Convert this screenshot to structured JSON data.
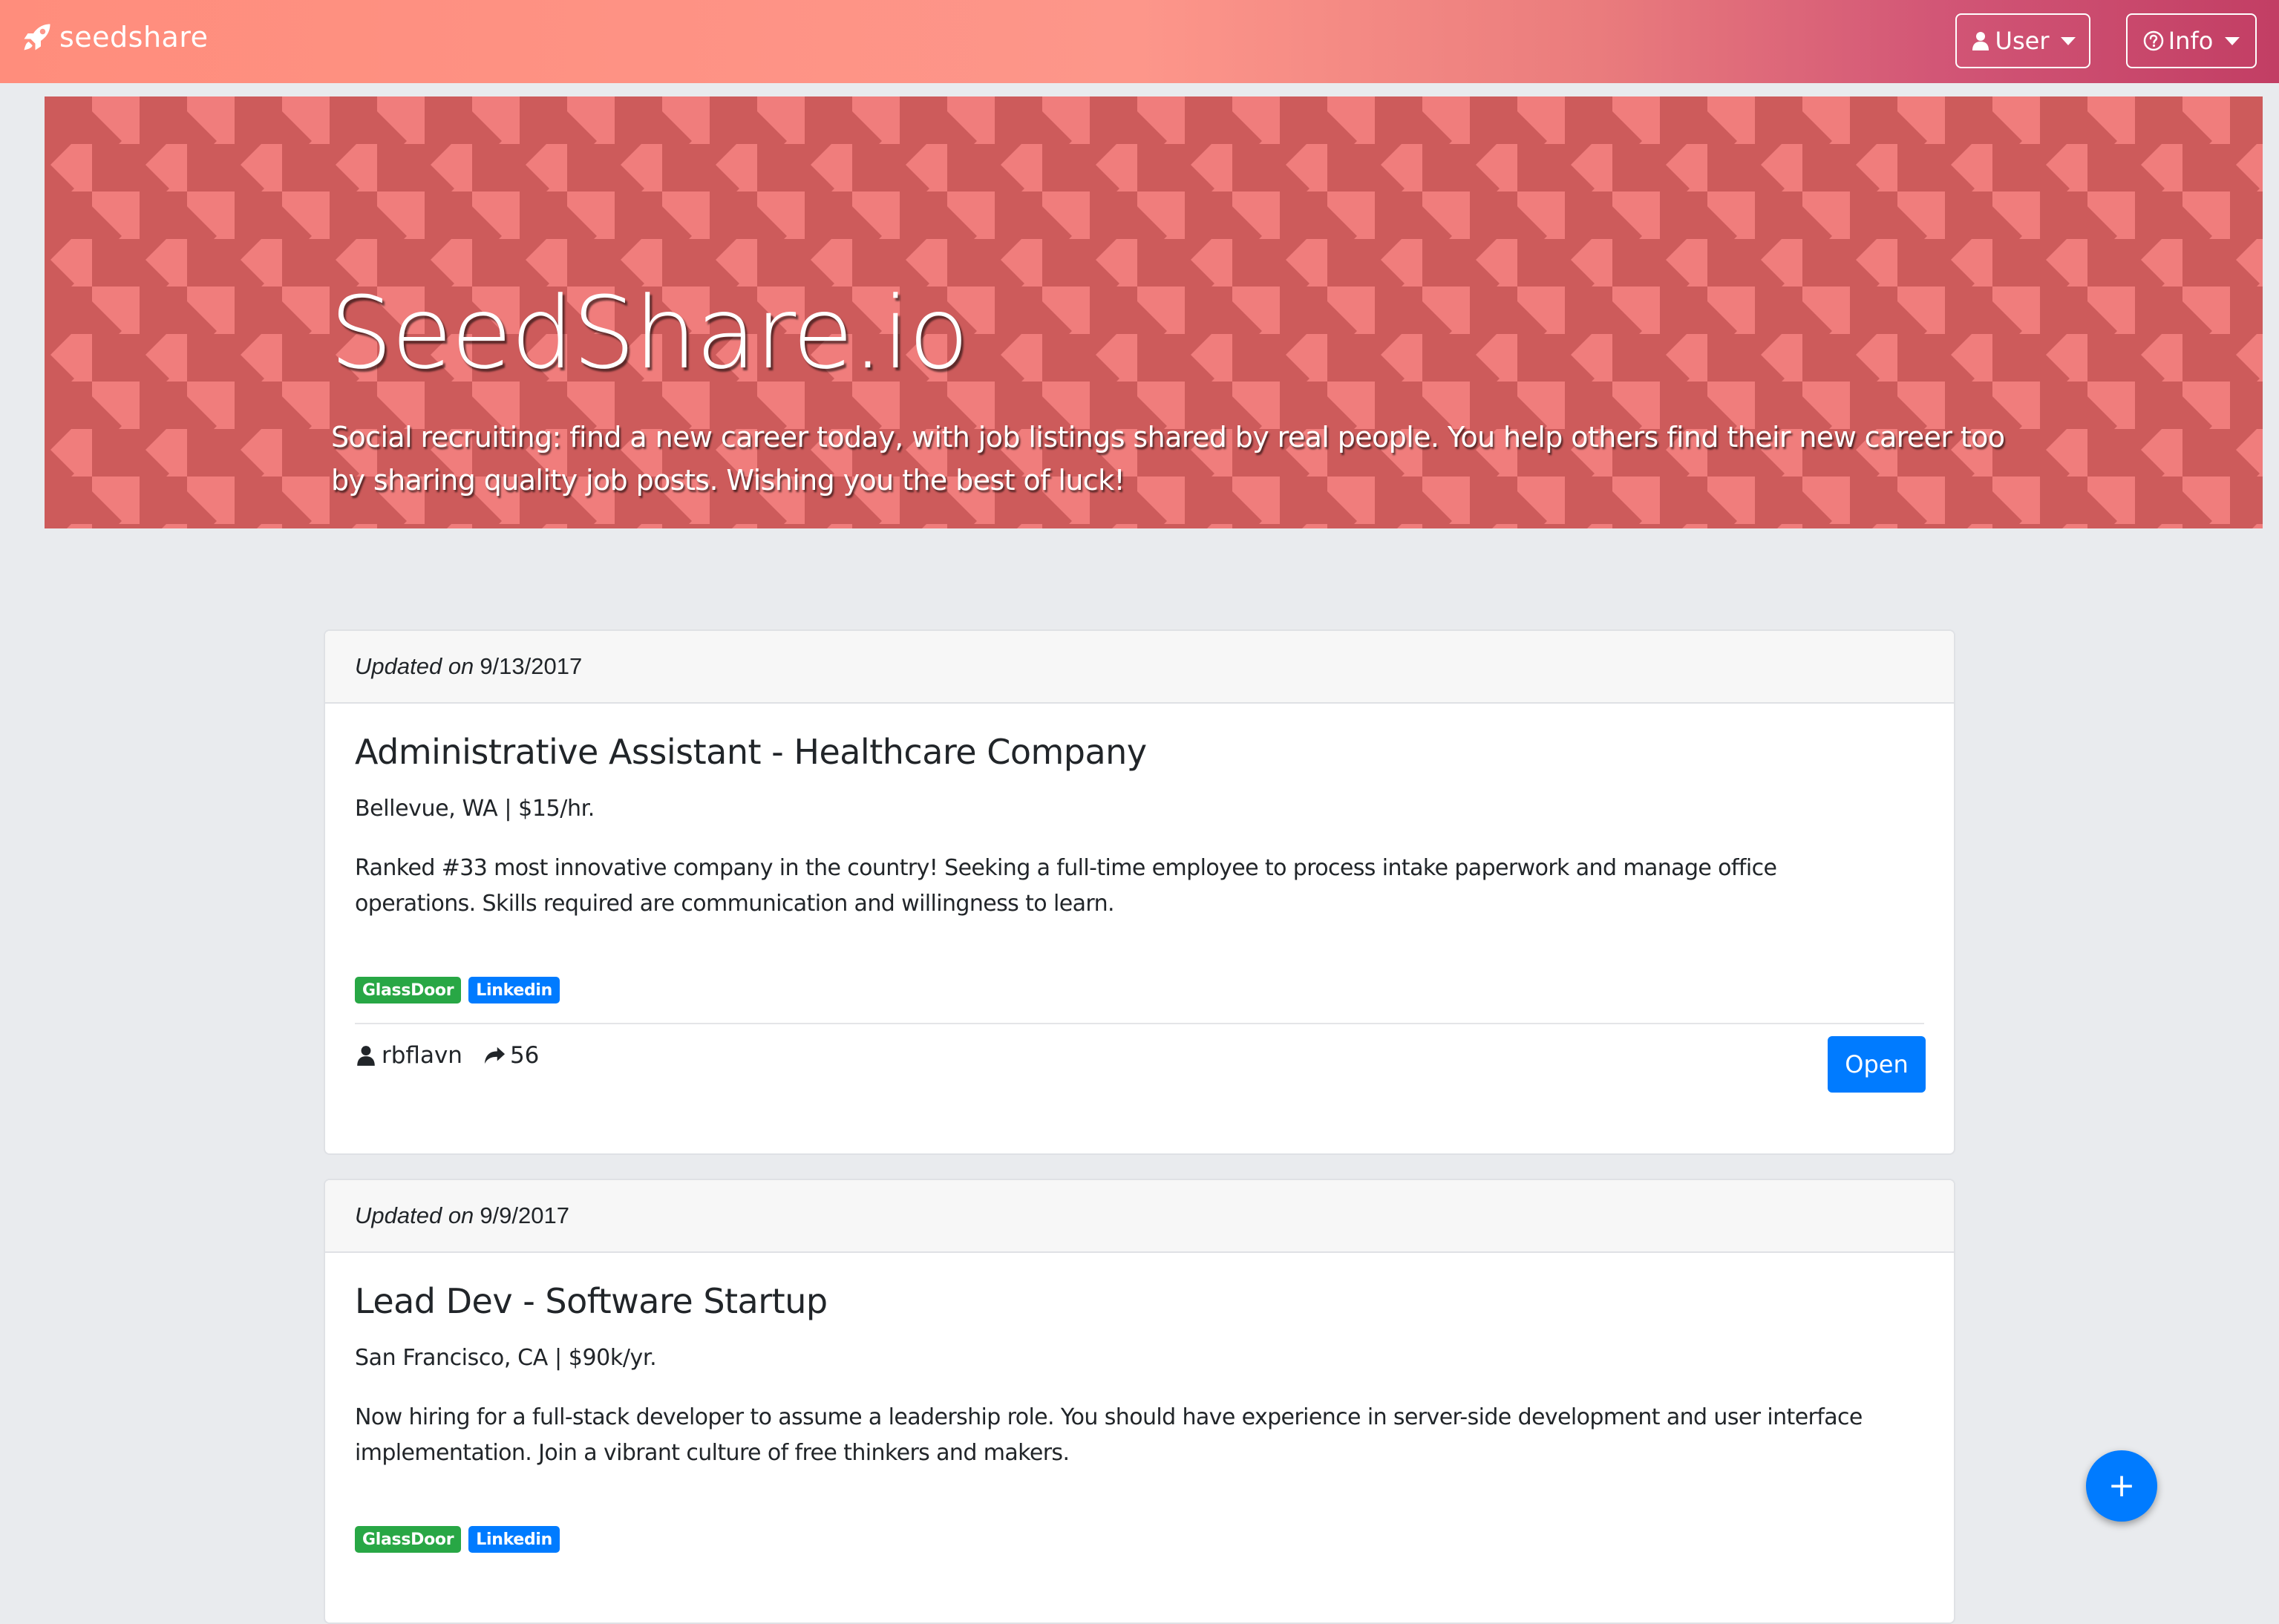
{
  "navbar": {
    "brand": "seedshare",
    "brand_icon": "rocket-icon",
    "user_label": "User",
    "user_icon": "user-icon",
    "info_label": "Info",
    "info_icon": "question-circle-icon",
    "gradient_colors": [
      "#ff8d7c",
      "#c23e64"
    ]
  },
  "hero": {
    "title": "SeedShare.io",
    "subtitle": "Social recruiting: find a new career today, with job listings shared by real people. You help others find their new career too by sharing quality job posts. Wishing you the best of luck!",
    "pattern_colors": [
      "#f07d7c",
      "#cd5b5b"
    ]
  },
  "jobs": [
    {
      "updated_prefix": "Updated on",
      "updated_date": "9/13/2017",
      "title": "Administrative Assistant - Healthcare Company",
      "meta": "Bellevue, WA | $15/hr.",
      "description": "Ranked #33 most innovative company in the country! Seeking a full-time employee to process intake paperwork and manage office operations. Skills required are communication and willingness to learn.",
      "tags": [
        "GlassDoor",
        "Linkedin"
      ],
      "author": "rbflavn",
      "shares": "56",
      "open_label": "Open"
    },
    {
      "updated_prefix": "Updated on",
      "updated_date": "9/9/2017",
      "title": "Lead Dev - Software Startup",
      "meta": "San Francisco, CA | $90k/yr.",
      "description": "Now hiring for a full-stack developer to assume a leadership role. You should have experience in server-side development and user interface implementation. Join a vibrant culture of free thinkers and makers.",
      "tags": [
        "GlassDoor",
        "Linkedin"
      ]
    }
  ],
  "fab": {
    "label": "+"
  },
  "colors": {
    "page_bg": "#e9ebee",
    "primary": "#007bff",
    "success": "#28a745"
  }
}
